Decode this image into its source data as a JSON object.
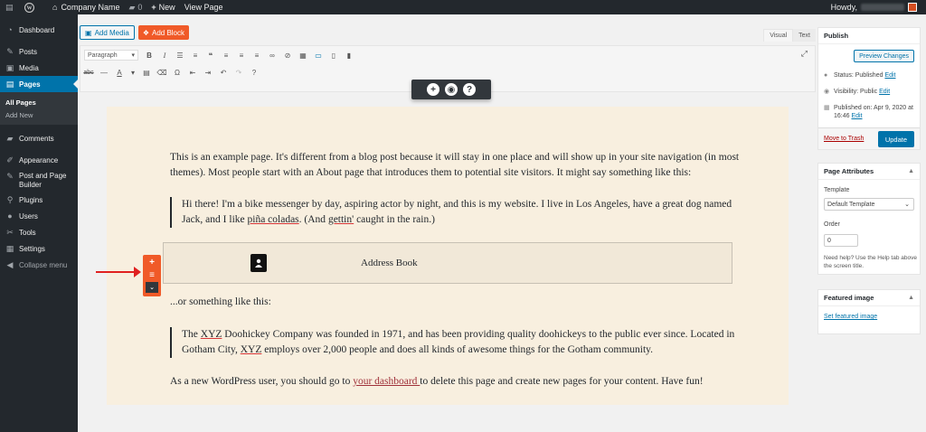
{
  "adminbar": {
    "site_name": "Company Name",
    "comments_count": "0",
    "new_label": "New",
    "view_page": "View Page",
    "howdy": "Howdy,"
  },
  "sidebar": {
    "items": [
      {
        "label": "Dashboard",
        "icon": "dashboard-icon"
      },
      {
        "label": "Posts",
        "icon": "pin-icon"
      },
      {
        "label": "Media",
        "icon": "media-icon"
      },
      {
        "label": "Pages",
        "icon": "pages-icon"
      },
      {
        "label": "Comments",
        "icon": "comment-icon"
      },
      {
        "label": "Appearance",
        "icon": "brush-icon"
      },
      {
        "label": "Post and Page Builder",
        "icon": "builder-icon"
      },
      {
        "label": "Plugins",
        "icon": "plugin-icon"
      },
      {
        "label": "Users",
        "icon": "user-icon"
      },
      {
        "label": "Tools",
        "icon": "wrench-icon"
      },
      {
        "label": "Settings",
        "icon": "settings-icon"
      },
      {
        "label": "Collapse menu",
        "icon": "collapse-icon"
      }
    ],
    "submenu": [
      "All Pages",
      "Add New"
    ]
  },
  "editor": {
    "add_media": "Add Media",
    "add_block": "Add Block",
    "tab_visual": "Visual",
    "tab_text": "Text",
    "format_select": "Paragraph",
    "content": {
      "p1": "This is an example page. It's different from a blog post because it will stay in one place and will show up in your site navigation (in most themes). Most people start with an About page that introduces them to potential site visitors. It might say something like this:",
      "q1_a": "Hi there! I'm a bike messenger by day, aspiring actor by night, and this is my website. I live in Los Angeles, have a great dog named Jack, and I like ",
      "q1_link": "piña coladas",
      "q1_b": ". (And ",
      "q1_link2": "gettin'",
      "q1_c": " caught in the rain.)",
      "block_label": "Address Book",
      "p2": "...or something like this:",
      "q2_a": "The ",
      "q2_xyz": "XYZ",
      "q2_b": " Doohickey Company was founded in 1971, and has been providing quality doohickeys to the public ever since. Located in Gotham City, ",
      "q2_xyz2": "XYZ",
      "q2_c": " employs over 2,000 people and does all kinds of awesome things for the Gotham community.",
      "p3_a": "As a new WordPress user, you should go to ",
      "p3_link": " your dashboard ",
      "p3_b": " to delete this page and create new pages for your content. Have fun!"
    }
  },
  "publish": {
    "title": "Publish",
    "preview": "Preview Changes",
    "status_label": "Status: Published",
    "visibility_label": "Visibility: Public",
    "published_on_a": "Published on: Apr 9, 2020 at",
    "published_on_b": "16:46",
    "edit": "Edit",
    "trash": "Move to Trash",
    "update": "Update"
  },
  "attributes": {
    "title": "Page Attributes",
    "template_label": "Template",
    "template_value": "Default Template",
    "order_label": "Order",
    "order_value": "0",
    "help": "Need help? Use the Help tab above the screen title."
  },
  "featured": {
    "title": "Featured image",
    "link": "Set featured image"
  },
  "colors": {
    "admin_dark": "#23282d",
    "primary": "#0073aa",
    "accent_orange": "#f05a28",
    "content_bg": "#f8efdf"
  }
}
